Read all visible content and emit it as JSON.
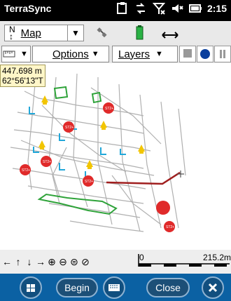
{
  "statusbar": {
    "app_title": "TerraSync",
    "time": "2:15"
  },
  "toolbar": {
    "map_label": "Map",
    "options_label": "Options",
    "layers_label": "Layers"
  },
  "map": {
    "distance": "447.698 m",
    "bearing": "62°56'13\"T",
    "scale_left": "0",
    "scale_right": "215.2m",
    "feature_labels": [
      "ST2+",
      "ST2+",
      "ST2+",
      "ST2+",
      "ST2+",
      "ST2+"
    ]
  },
  "bottom": {
    "begin_label": "Begin",
    "close_label": "Close"
  },
  "colors": {
    "status_bg": "#000000",
    "bottom_bg": "#0b61a3",
    "toolbar_bg": "#e9e9e9",
    "street": "#b0b0b0",
    "green_line": "#2fa33a",
    "cyan_line": "#21a7d9",
    "red_point": "#e02a2a",
    "yellow_point": "#f2c500",
    "dark_red_line": "#a01f1f"
  }
}
